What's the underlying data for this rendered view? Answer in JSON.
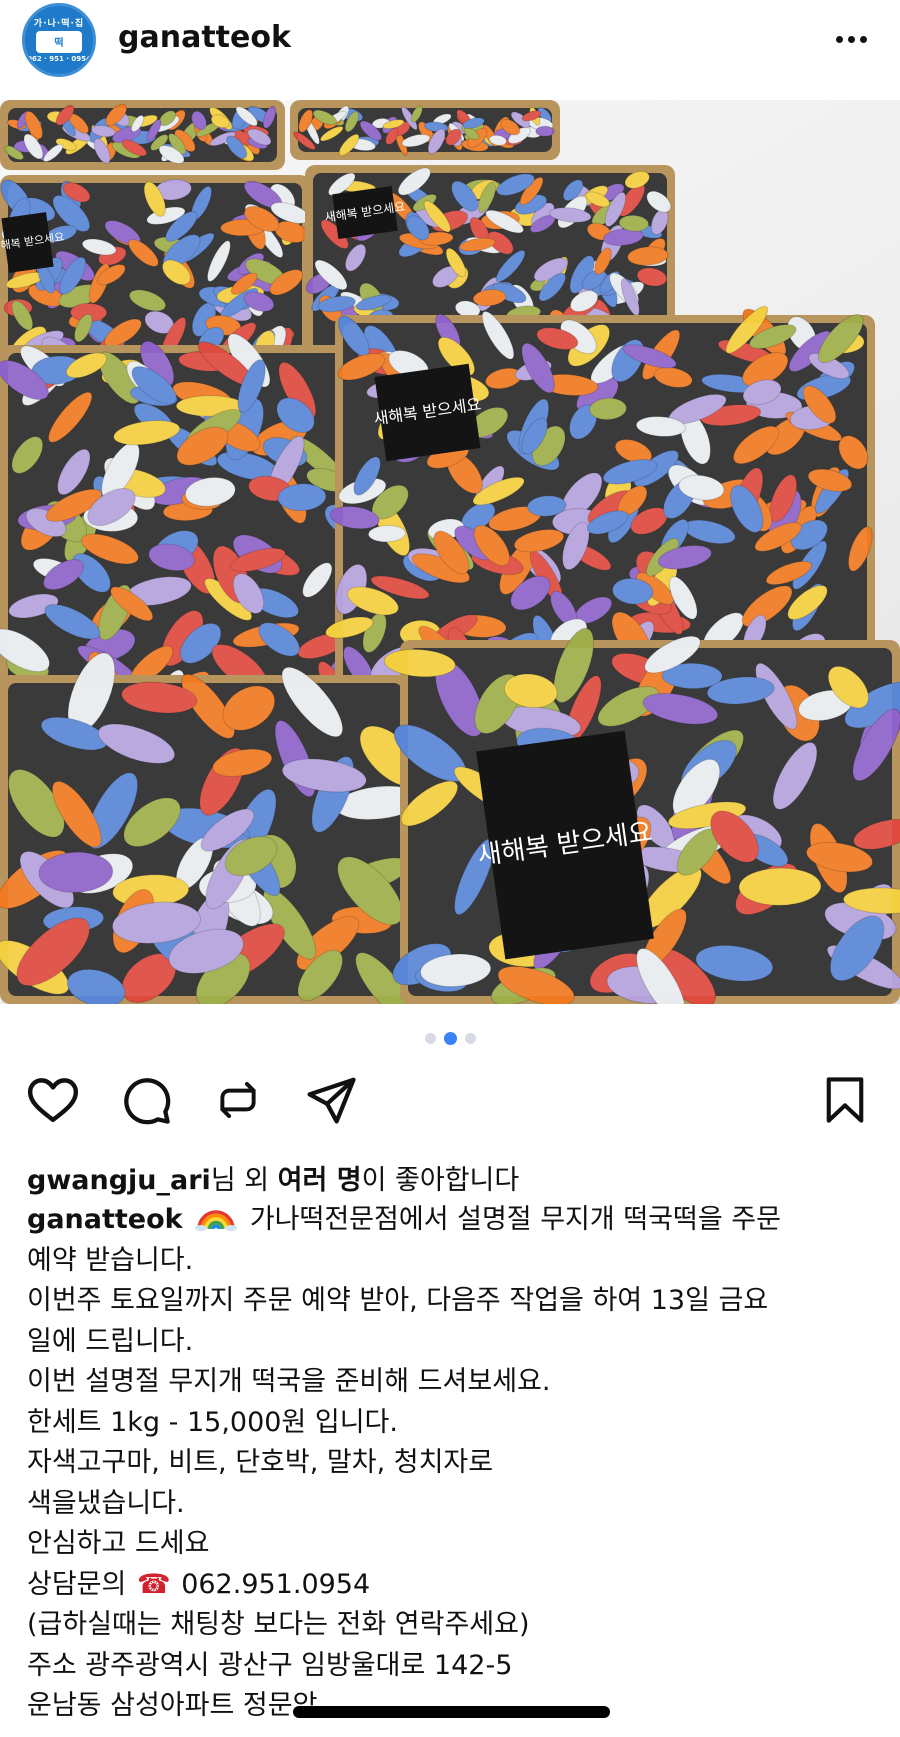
{
  "header": {
    "username": "ganatteok",
    "avatar_top": "가·나·떡·집",
    "avatar_phone": "062 · 951 · 0954"
  },
  "carousel": {
    "count": 3,
    "active": 2
  },
  "likes": {
    "user": "gwangju_ari",
    "mid": "님 외 ",
    "bold": "여러 명",
    "tail": "이 좋아합니다"
  },
  "caption": {
    "user": "ganatteok",
    "lines": [
      "가나떡전문점에서 설명절 무지개 떡국떡을 주문",
      "예약 받습니다.",
      "이번주 토요일까지 주문 예약 받아, 다음주 작업을 하여 13일 금요",
      "일에 드립니다.",
      "이번 설명절 무지개 떡국을 준비해 드셔보세요.",
      "한세트 1kg - 15,000원 입니다.",
      "자색고구마, 비트, 단호박, 말차, 청치자로",
      "색을냈습니다.",
      "안심하고 드세요",
      "062.951.0954",
      "(급하실때는 채팅창 보다는 전화 연락주세요)",
      "주소 광주광역시 광산구 임방울대로 142-5",
      "운남동 삼성아파트 정문앞"
    ],
    "phone_label": "상담문의",
    "phone_icon": "telephone-icon"
  },
  "photo": {
    "label_text": "새해복 받으세요",
    "colors": {
      "purple": "#8e62c8",
      "blue": "#5a86d6",
      "orange": "#f07a22",
      "red": "#de4a3e",
      "yellow": "#f3cf3f",
      "green": "#9fae4a",
      "white": "#e8ecef",
      "lavender": "#b5a2dc",
      "tray": "#2a2a2a",
      "box": "#b8955c"
    }
  },
  "icons": {
    "like": "heart-icon",
    "comment": "comment-icon",
    "repost": "repost-icon",
    "share": "send-icon",
    "save": "bookmark-icon",
    "more": "more-icon"
  }
}
